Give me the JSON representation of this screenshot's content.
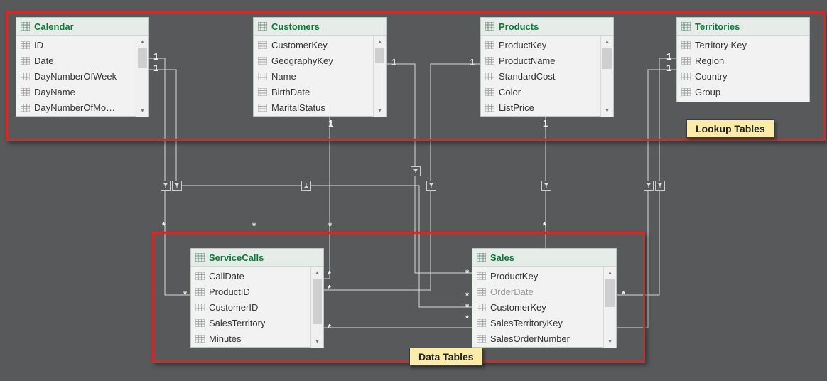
{
  "groups": {
    "lookup_label": "Lookup Tables",
    "data_label": "Data Tables"
  },
  "cardinality": {
    "one": "1",
    "many": "*"
  },
  "tables": {
    "calendar": {
      "title": "Calendar",
      "fields": [
        "ID",
        "Date",
        "DayNumberOfWeek",
        "DayName",
        "DayNumberOfMo…"
      ]
    },
    "customers": {
      "title": "Customers",
      "fields": [
        "CustomerKey",
        "GeographyKey",
        "Name",
        "BirthDate",
        "MaritalStatus"
      ]
    },
    "products": {
      "title": "Products",
      "fields": [
        "ProductKey",
        "ProductName",
        "StandardCost",
        "Color",
        "ListPrice"
      ]
    },
    "territories": {
      "title": "Territories",
      "fields": [
        "Territory Key",
        "Region",
        "Country",
        "Group"
      ]
    },
    "servicecalls": {
      "title": "ServiceCalls",
      "fields": [
        "CallDate",
        "ProductID",
        "CustomerID",
        "SalesTerritory",
        "Minutes"
      ]
    },
    "sales": {
      "title": "Sales",
      "fields": [
        "ProductKey",
        "OrderDate",
        "CustomerKey",
        "SalesTerritoryKey",
        "SalesOrderNumber"
      ],
      "dim_index": 1
    }
  },
  "relationships": [
    {
      "from": "calendar",
      "to": "servicecalls",
      "from_card": "1",
      "to_card": "*"
    },
    {
      "from": "calendar",
      "to": "sales",
      "from_card": "1",
      "to_card": "*"
    },
    {
      "from": "customers",
      "to": "servicecalls",
      "from_card": "1",
      "to_card": "*"
    },
    {
      "from": "customers",
      "to": "sales",
      "from_card": "1",
      "to_card": "*"
    },
    {
      "from": "products",
      "to": "servicecalls",
      "from_card": "1",
      "to_card": "*"
    },
    {
      "from": "products",
      "to": "sales",
      "from_card": "1",
      "to_card": "*"
    },
    {
      "from": "territories",
      "to": "servicecalls",
      "from_card": "1",
      "to_card": "*"
    },
    {
      "from": "territories",
      "to": "sales",
      "from_card": "1",
      "to_card": "*"
    }
  ]
}
